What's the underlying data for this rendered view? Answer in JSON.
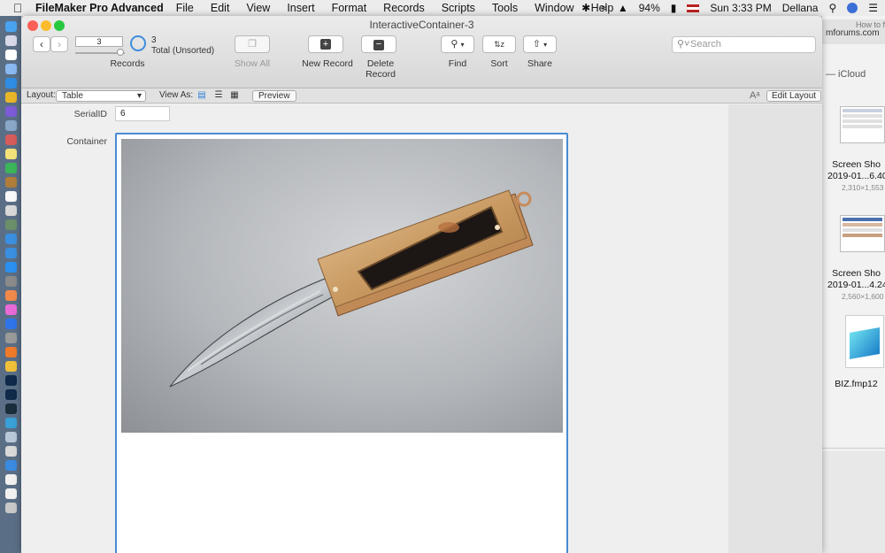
{
  "menubar": {
    "app_name": "FileMaker Pro Advanced",
    "items": [
      "File",
      "Edit",
      "View",
      "Insert",
      "Format",
      "Records",
      "Scripts",
      "Tools",
      "Window",
      "Help"
    ],
    "battery": "94%",
    "clock": "Sun 3:33 PM",
    "user": "Dellana"
  },
  "window": {
    "title": "InteractiveContainer-3"
  },
  "toolbar": {
    "record_number": "3",
    "total_count": "3",
    "total_label": "Total (Unsorted)",
    "records_label": "Records",
    "show_all_label": "Show All",
    "new_record_label": "New Record",
    "delete_record_label": "Delete Record",
    "find_label": "Find",
    "sort_label": "Sort",
    "share_label": "Share",
    "search_placeholder": "Search"
  },
  "layoutbar": {
    "layout_label": "Layout:",
    "layout_value": "Table",
    "view_as_label": "View As:",
    "preview_label": "Preview",
    "edit_layout_label": "Edit Layout"
  },
  "form": {
    "serial_label": "SerialID",
    "serial_value": "6",
    "container_label": "Container"
  },
  "background_window": {
    "tab": "mforums.com",
    "tab2": "How to f",
    "sidebar": "— iCloud",
    "files": [
      {
        "name1": "Screen Sho",
        "name2": "2019-01...6.40",
        "size": "2,310×1,553"
      },
      {
        "name1": "Screen Sho",
        "name2": "2019-01...4.24",
        "size": "2,560×1,600"
      },
      {
        "name1": "BIZ.fmp12",
        "name2": "",
        "size": ""
      }
    ]
  },
  "colors": {
    "accent": "#4a8ad3",
    "close": "#fc5f57",
    "minimize": "#fdbc2e",
    "zoom": "#28c840"
  }
}
